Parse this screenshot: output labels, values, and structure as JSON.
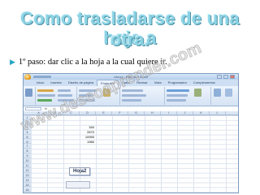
{
  "slide": {
    "title_line1": "Como trasladarse de una hoja a",
    "title_line2": "otra.",
    "bullet_text": "1º paso: dar clic a la hoja a la cual quiere ir."
  },
  "excel": {
    "window_title": "Libro1 - Microsoft Excel",
    "tabs": [
      "Inicio",
      "Insertar",
      "Diseño de página",
      "Fórmulas",
      "Datos",
      "Revisar",
      "Vista",
      "Programador",
      "Complementos"
    ],
    "active_tab": "Fórmulas",
    "formula_bar_label": "fx",
    "columns": [
      "A",
      "B",
      "C",
      "D",
      "E",
      "F",
      "G",
      "H",
      "I",
      "J",
      "K",
      "L"
    ],
    "rows": [
      "1",
      "2",
      "3",
      "4",
      "5",
      "6",
      "7",
      "8",
      "9",
      "10",
      "11",
      "12",
      "13",
      "14",
      "15",
      "16"
    ],
    "cells": [
      "340",
      "2670",
      "10990",
      "1980"
    ],
    "sheet_tab_label": "Hoja2"
  },
  "watermark": "www.deseoaprender.com",
  "colors": {
    "title_fill": "#8bd3e4",
    "title_outline": "#4d8fa3",
    "bullet_marker": "#2aa6c4",
    "ribbon_bg": "#dfe9f6"
  }
}
